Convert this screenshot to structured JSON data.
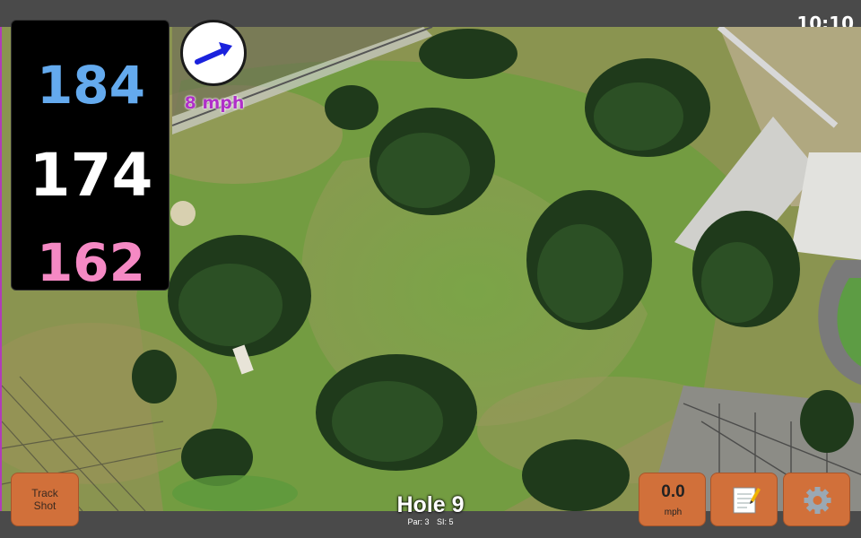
{
  "status_bar": {
    "time": "10:10"
  },
  "distances": {
    "back": "184",
    "middle": "174",
    "front": "162"
  },
  "wind": {
    "speed_label": "8 mph",
    "direction_icon": "arrow-up-right-icon"
  },
  "hole": {
    "title": "Hole 9",
    "par": "Par: 3",
    "stroke_index": "SI: 5"
  },
  "buttons": {
    "track_shot": {
      "line1": "Track",
      "line2": "Shot"
    },
    "wind_speed": {
      "value": "0.0",
      "unit": "mph"
    },
    "notes": {
      "icon": "notepad-icon"
    },
    "settings": {
      "icon": "gear-icon"
    }
  },
  "colors": {
    "back": "#64aaee",
    "middle": "#ffffff",
    "front": "#f589c4",
    "button": "#d1703a",
    "wind_text": "#b030c8",
    "map_border": "#b03cb8"
  }
}
